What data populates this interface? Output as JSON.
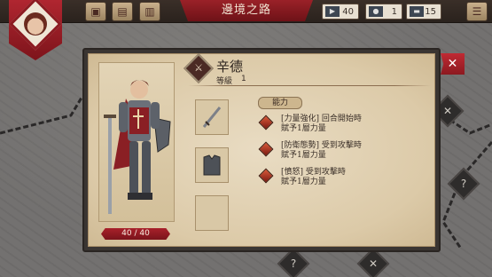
{
  "header": {
    "title": "邊境之路"
  },
  "resources": [
    {
      "icon": "flag-icon",
      "value": "40"
    },
    {
      "icon": "water-drop-icon",
      "value": "1"
    },
    {
      "icon": "scroll-icon",
      "value": "15"
    }
  ],
  "character": {
    "name": "辛德",
    "level_label": "等級",
    "level": "1",
    "hp": "40 / 40"
  },
  "skills_tab": "能力",
  "skills": [
    {
      "line1": "[力量強化] 回合開始時",
      "line2": "賦予1層力量"
    },
    {
      "line1": "[防衛態勢] 受到攻擊時",
      "line2": "賦予1層力量"
    },
    {
      "line1": "[憤怒] 受到攻擊時",
      "line2": "賦予1層力量"
    }
  ],
  "colors": {
    "accent_red": "#9a2128",
    "parchment": "#e3d4b6",
    "panel_dark": "#3a3532"
  }
}
